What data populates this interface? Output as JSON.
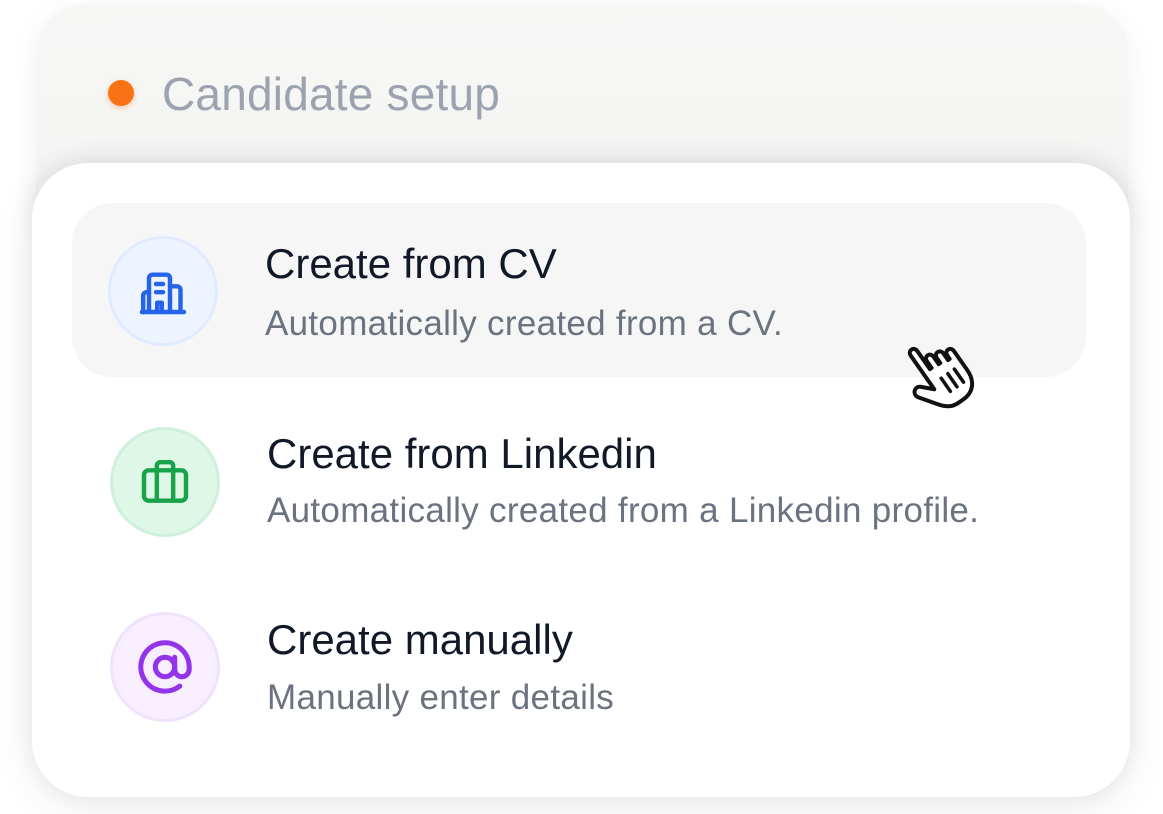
{
  "header": {
    "title": "Candidate setup",
    "status_color": "#f97316"
  },
  "options": [
    {
      "title": "Create from CV",
      "subtitle": "Automatically created from a CV.",
      "icon": "building-icon",
      "accent": "#2563eb",
      "state": "hovered"
    },
    {
      "title": "Create from Linkedin",
      "subtitle": "Automatically created from a Linkedin profile.",
      "icon": "briefcase-icon",
      "accent": "#16a34a"
    },
    {
      "title": "Create manually",
      "subtitle": "Manually enter details",
      "icon": "at-sign-icon",
      "accent": "#9333ea"
    }
  ],
  "cursor": {
    "icon": "hand-pointer-icon"
  }
}
